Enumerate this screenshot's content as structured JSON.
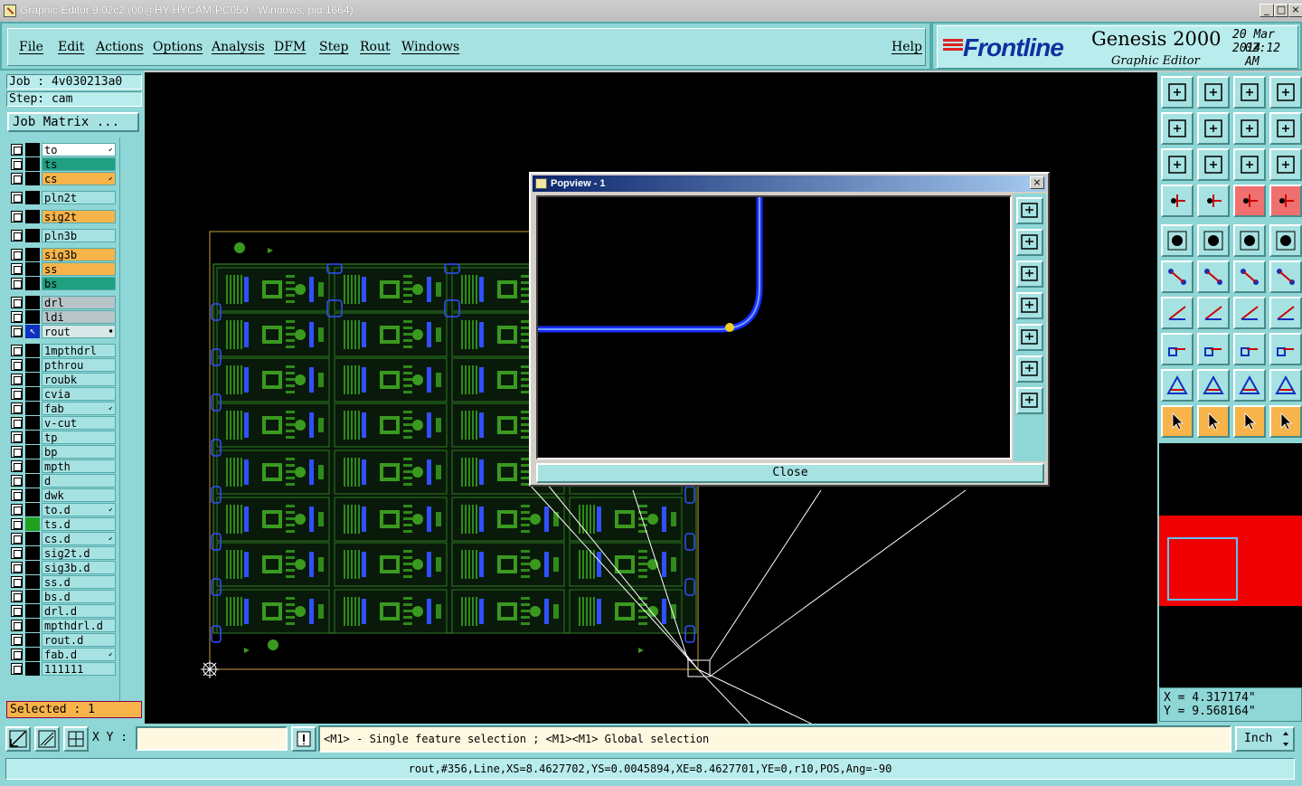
{
  "window": {
    "title": "Graphic Editor 9.02c2 (00@HY-HYCAM-PC050 - Windows, pid:1664)",
    "minimize": "_",
    "maximize": "□",
    "close": "×"
  },
  "menu": [
    "File",
    "Edit",
    "Actions",
    "Options",
    "Analysis",
    "DFM",
    "Step",
    "Rout",
    "Windows"
  ],
  "help": "Help",
  "brand": {
    "logo": "Frontline",
    "product": "Genesis 2000",
    "subtitle": "Graphic Editor",
    "date": "20 Mar 2014",
    "time": "02:12 AM"
  },
  "job": {
    "job_line": "Job : 4v030213a0",
    "step_line": "Step: cam",
    "matrix_button": "Job Matrix ..."
  },
  "layers": [
    {
      "name": "to",
      "color": "#ffffff",
      "mark": "↙"
    },
    {
      "name": "ts",
      "color": "#20a080",
      "mark": ""
    },
    {
      "name": "cs",
      "color": "#f7b44a",
      "mark": "↙"
    },
    {
      "name": "pln2t",
      "color": "#a7e2e2",
      "mark": ""
    },
    {
      "name": "sig2t",
      "color": "#f7b44a",
      "mark": ""
    },
    {
      "name": "pln3b",
      "color": "#a7e2e2",
      "mark": ""
    },
    {
      "name": "sig3b",
      "color": "#f7b44a",
      "mark": ""
    },
    {
      "name": "ss",
      "color": "#f7b44a",
      "mark": ""
    },
    {
      "name": "bs",
      "color": "#20a080",
      "mark": ""
    },
    {
      "name": "drl",
      "color": "#b8c4c8",
      "mark": ""
    },
    {
      "name": "ldi",
      "color": "#b8c4c8",
      "mark": ""
    },
    {
      "name": "rout",
      "color": "#d8e8e8",
      "mark": "▪"
    },
    {
      "name": "1mpthdrl",
      "color": "#a7e2e2",
      "mark": ""
    },
    {
      "name": "pthrou",
      "color": "#a7e2e2",
      "mark": ""
    },
    {
      "name": "roubk",
      "color": "#a7e2e2",
      "mark": ""
    },
    {
      "name": "cvia",
      "color": "#a7e2e2",
      "mark": ""
    },
    {
      "name": "fab",
      "color": "#a7e2e2",
      "mark": "↙"
    },
    {
      "name": "v-cut",
      "color": "#a7e2e2",
      "mark": ""
    },
    {
      "name": "tp",
      "color": "#a7e2e2",
      "mark": ""
    },
    {
      "name": "bp",
      "color": "#a7e2e2",
      "mark": ""
    },
    {
      "name": "mpth",
      "color": "#a7e2e2",
      "mark": ""
    },
    {
      "name": "d",
      "color": "#a7e2e2",
      "mark": ""
    },
    {
      "name": "dwk",
      "color": "#a7e2e2",
      "mark": ""
    },
    {
      "name": "to.d",
      "color": "#a7e2e2",
      "mark": "↙"
    },
    {
      "name": "ts.d",
      "color": "#a7e2e2",
      "mark": ""
    },
    {
      "name": "cs.d",
      "color": "#a7e2e2",
      "mark": "↙"
    },
    {
      "name": "sig2t.d",
      "color": "#a7e2e2",
      "mark": ""
    },
    {
      "name": "sig3b.d",
      "color": "#a7e2e2",
      "mark": ""
    },
    {
      "name": "ss.d",
      "color": "#a7e2e2",
      "mark": ""
    },
    {
      "name": "bs.d",
      "color": "#a7e2e2",
      "mark": ""
    },
    {
      "name": "drl.d",
      "color": "#a7e2e2",
      "mark": ""
    },
    {
      "name": "mpthdrl.d",
      "color": "#a7e2e2",
      "mark": ""
    },
    {
      "name": "rout.d",
      "color": "#a7e2e2",
      "mark": ""
    },
    {
      "name": "fab.d",
      "color": "#a7e2e2",
      "mark": "↙"
    },
    {
      "name": "111111",
      "color": "#a7e2e2",
      "mark": ""
    }
  ],
  "selected": "Selected : 1",
  "popview": {
    "title": "Popview - 1",
    "close_label": "Close"
  },
  "coords": {
    "x": "X = 4.317174\"",
    "y": "Y = 9.568164\""
  },
  "bottom": {
    "xy_label": "X Y :",
    "xy_value": "",
    "hint": "<M1> - Single feature selection ; <M1><M1> Global selection",
    "units": "Inch"
  },
  "status": "rout,#356,Line,XS=8.4627702,YS=0.0045894,XE=8.4627701,YE=0,r10,POS,Ang=-90",
  "colors": {
    "panel": "#8fd6d6",
    "accent_orange": "#f7b44a",
    "pcb_green": "#3a9a20",
    "rout_blue": "#2040ff"
  }
}
